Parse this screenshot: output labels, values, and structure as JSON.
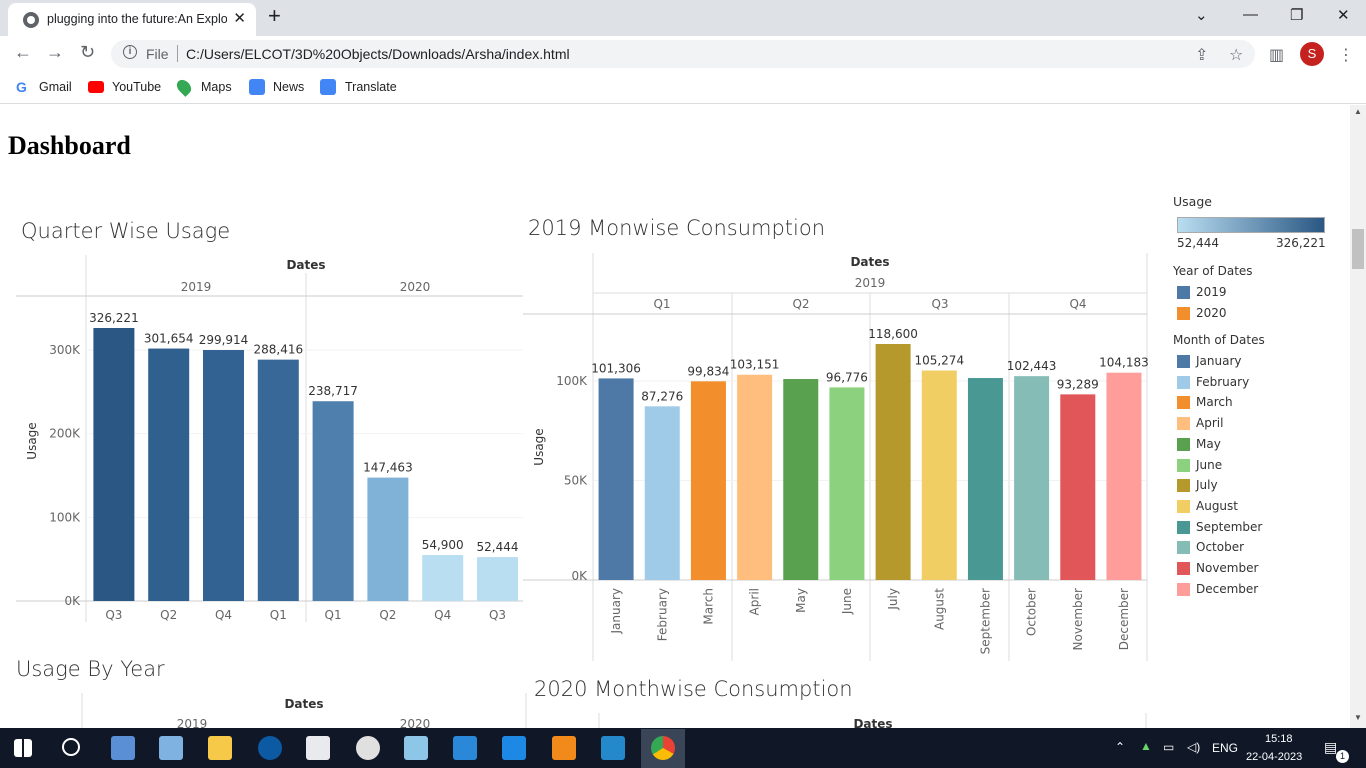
{
  "browser": {
    "tab_title": "plugging into the future:An Explo",
    "url_scheme": "File",
    "url": "C:/Users/ELCOT/3D%20Objects/Downloads/Arsha/index.html",
    "avatar_letter": "S",
    "bookmarks": [
      {
        "label": "Gmail",
        "icon": "gmail-icon",
        "color": "#4285f4"
      },
      {
        "label": "YouTube",
        "icon": "youtube-icon",
        "color": "#ff0000"
      },
      {
        "label": "Maps",
        "icon": "maps-icon",
        "color": "#34a853"
      },
      {
        "label": "News",
        "icon": "news-icon",
        "color": "#4285f4"
      },
      {
        "label": "Translate",
        "icon": "translate-icon",
        "color": "#4285f4"
      }
    ]
  },
  "page": {
    "heading": "Dashboard"
  },
  "charts": {
    "quarter": {
      "title": "Quarter Wise Usage",
      "dates_header": "Dates",
      "ylabel": "Usage",
      "years": [
        "2019",
        "2020"
      ]
    },
    "mon2019": {
      "title": "2019 Monwise Consumption",
      "dates_header": "Dates",
      "year": "2019",
      "ylabel": "Usage",
      "quarters": [
        "Q1",
        "Q2",
        "Q3",
        "Q4"
      ]
    },
    "year": {
      "title": "Usage By Year",
      "dates_header": "Dates",
      "years": [
        "2019",
        "2020"
      ]
    },
    "mon2020": {
      "title": "2020 Monthwise Consumption",
      "dates_header": "Dates"
    }
  },
  "legend": {
    "usage_title": "Usage",
    "usage_min": "52,444",
    "usage_max": "326,221",
    "usage_gradient": [
      "#b9ddf1",
      "#2a5783"
    ],
    "year_title": "Year of Dates",
    "years": [
      {
        "label": "2019",
        "color": "#4e79a7"
      },
      {
        "label": "2020",
        "color": "#f28e2b"
      }
    ],
    "month_title": "Month of Dates",
    "months": [
      {
        "label": "January",
        "color": "#4e79a7"
      },
      {
        "label": "February",
        "color": "#a0cbe8"
      },
      {
        "label": "March",
        "color": "#f28e2b"
      },
      {
        "label": "April",
        "color": "#ffbe7d"
      },
      {
        "label": "May",
        "color": "#59a14f"
      },
      {
        "label": "June",
        "color": "#8cd17d"
      },
      {
        "label": "July",
        "color": "#b6992d"
      },
      {
        "label": "August",
        "color": "#f1ce63"
      },
      {
        "label": "September",
        "color": "#499894"
      },
      {
        "label": "October",
        "color": "#86bcb6"
      },
      {
        "label": "November",
        "color": "#e15759"
      },
      {
        "label": "December",
        "color": "#ff9d9a"
      }
    ]
  },
  "chart_data": [
    {
      "type": "bar",
      "title": "Quarter Wise Usage",
      "ylabel": "Usage",
      "groups": [
        "2019",
        "2020"
      ],
      "categories": [
        "Q3",
        "Q2",
        "Q4",
        "Q1",
        "Q1",
        "Q2",
        "Q4",
        "Q3"
      ],
      "group_of": [
        "2019",
        "2019",
        "2019",
        "2019",
        "2020",
        "2020",
        "2020",
        "2020"
      ],
      "values": [
        326221,
        301654,
        299914,
        288416,
        238717,
        147463,
        54900,
        52444
      ],
      "value_labels": [
        "326,221",
        "301,654",
        "299,914",
        "288,416",
        "238,717",
        "147,463",
        "54,900",
        "52,444"
      ],
      "colors": [
        "#2a5783",
        "#30608e",
        "#326292",
        "#376898",
        "#4e7fad",
        "#80b1d6",
        "#b9ddf1",
        "#b9ddf1"
      ],
      "yticks": [
        0,
        100000,
        200000,
        300000
      ],
      "ytick_labels": [
        "0K",
        "100K",
        "200K",
        "300K"
      ],
      "ylim": [
        0,
        326221
      ]
    },
    {
      "type": "bar",
      "title": "2019 Monwise Consumption",
      "ylabel": "Usage",
      "categories": [
        "January",
        "February",
        "March",
        "April",
        "May",
        "June",
        "July",
        "August",
        "September",
        "October",
        "November",
        "December"
      ],
      "quarter_of": [
        "Q1",
        "Q1",
        "Q1",
        "Q2",
        "Q2",
        "Q2",
        "Q3",
        "Q3",
        "Q3",
        "Q4",
        "Q4",
        "Q4"
      ],
      "values": [
        101306,
        87276,
        99834,
        103151,
        101000,
        96776,
        118600,
        105274,
        101500,
        102443,
        93289,
        104183
      ],
      "value_labels": [
        "101,306",
        "87,276",
        "99,834",
        "103,151",
        "",
        "96,776",
        "118,600",
        "105,274",
        "",
        "102,443",
        "93,289",
        "104,183"
      ],
      "colors": [
        "#4e79a7",
        "#a0cbe8",
        "#f28e2b",
        "#ffbe7d",
        "#59a14f",
        "#8cd17d",
        "#b6992d",
        "#f1ce63",
        "#499894",
        "#86bcb6",
        "#e15759",
        "#ff9d9a"
      ],
      "yticks": [
        0,
        50000,
        100000
      ],
      "ytick_labels": [
        "0K",
        "50K",
        "100K"
      ],
      "ylim": [
        0,
        118600
      ]
    }
  ],
  "taskbar": {
    "lang": "ENG",
    "time": "15:18",
    "date": "22-04-2023",
    "notif_count": "1"
  }
}
